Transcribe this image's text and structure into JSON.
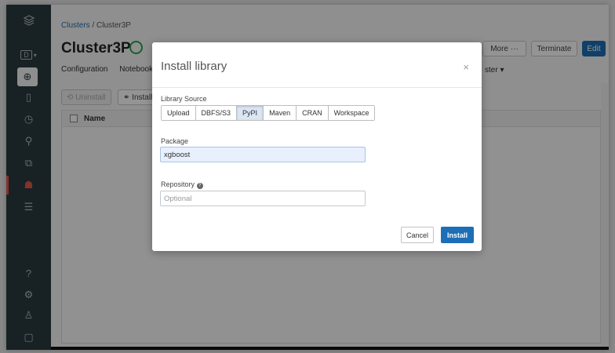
{
  "sidebar": {
    "icons": [
      "layers-icon",
      "workspace-dropdown-icon",
      "plus-circle-icon",
      "notebook-icon",
      "history-icon",
      "search-icon",
      "shapes-icon",
      "clusters-icon",
      "jobs-icon",
      "help-icon",
      "settings-icon",
      "user-icon",
      "panel-toggle-icon"
    ],
    "workspace_label": "D"
  },
  "breadcrumb": {
    "link": "Clusters",
    "separator": " / ",
    "current": "Cluster3P"
  },
  "page": {
    "title": "Cluster3P",
    "tabs": [
      "Configuration",
      "Notebooks"
    ],
    "more_label": "More",
    "more_dots": "···",
    "terminate_label": "Terminate",
    "edit_label": "Edit",
    "cluster_dropdown": "ster"
  },
  "toolbar": {
    "uninstall_label": "Uninstall",
    "install_label": "Install"
  },
  "table": {
    "name_header": "Name"
  },
  "modal": {
    "title": "Install library",
    "close": "×",
    "source_label": "Library Source",
    "sources": [
      "Upload",
      "DBFS/S3",
      "PyPI",
      "Maven",
      "CRAN",
      "Workspace"
    ],
    "selected_source": "PyPI",
    "package_label": "Package",
    "package_value": "xgboost",
    "repository_label": "Repository",
    "repository_placeholder": "Optional",
    "cancel_label": "Cancel",
    "install_label": "Install"
  }
}
